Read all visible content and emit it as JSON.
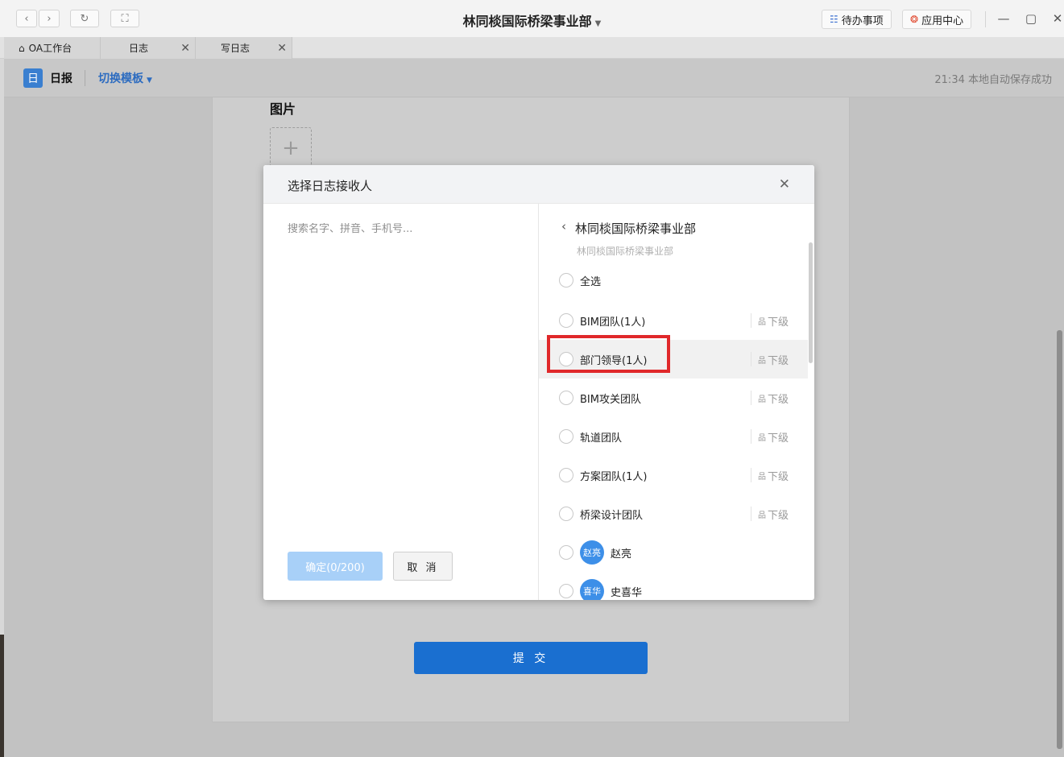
{
  "window": {
    "title": "林同棪国际桥梁事业部",
    "todo_label": "待办事项",
    "app_center_label": "应用中心",
    "controls": [
      "minimize-icon",
      "maximize-icon",
      "close-icon"
    ]
  },
  "tabs": [
    {
      "label": "OA工作台",
      "icon": "home-icon",
      "closable": false
    },
    {
      "label": "日志",
      "closable": true
    },
    {
      "label": "写日志",
      "closable": true
    }
  ],
  "header": {
    "badge": "日",
    "doc_type": "日报",
    "switch_template": "切换模板",
    "autosave": "21:34 本地自动保存成功"
  },
  "form": {
    "image_label": "图片",
    "submit_label": "提 交"
  },
  "modal": {
    "title": "选择日志接收人",
    "search_placeholder": "搜索名字、拼音、手机号...",
    "confirm_label": "确定(0/200)",
    "cancel_label": "取 消",
    "org_title": "林同棪国际桥梁事业部",
    "org_crumb": "林同棪国际桥梁事业部",
    "select_all": "全选",
    "sub_label": "下级",
    "groups": [
      {
        "label": "BIM团队(1人)",
        "highlighted": false
      },
      {
        "label": "部门领导(1人)",
        "highlighted": true
      },
      {
        "label": "BIM攻关团队",
        "highlighted": false
      },
      {
        "label": "轨道团队",
        "highlighted": false
      },
      {
        "label": "方案团队(1人)",
        "highlighted": false
      },
      {
        "label": "桥梁设计团队",
        "highlighted": false
      }
    ],
    "people": [
      {
        "avatar": "赵亮",
        "name": "赵亮"
      },
      {
        "avatar": "喜华",
        "name": "史喜华"
      }
    ]
  },
  "colors": {
    "accent": "#1a6fd0",
    "avatar": "#3d8fe8",
    "highlight_box": "#e0282a"
  }
}
